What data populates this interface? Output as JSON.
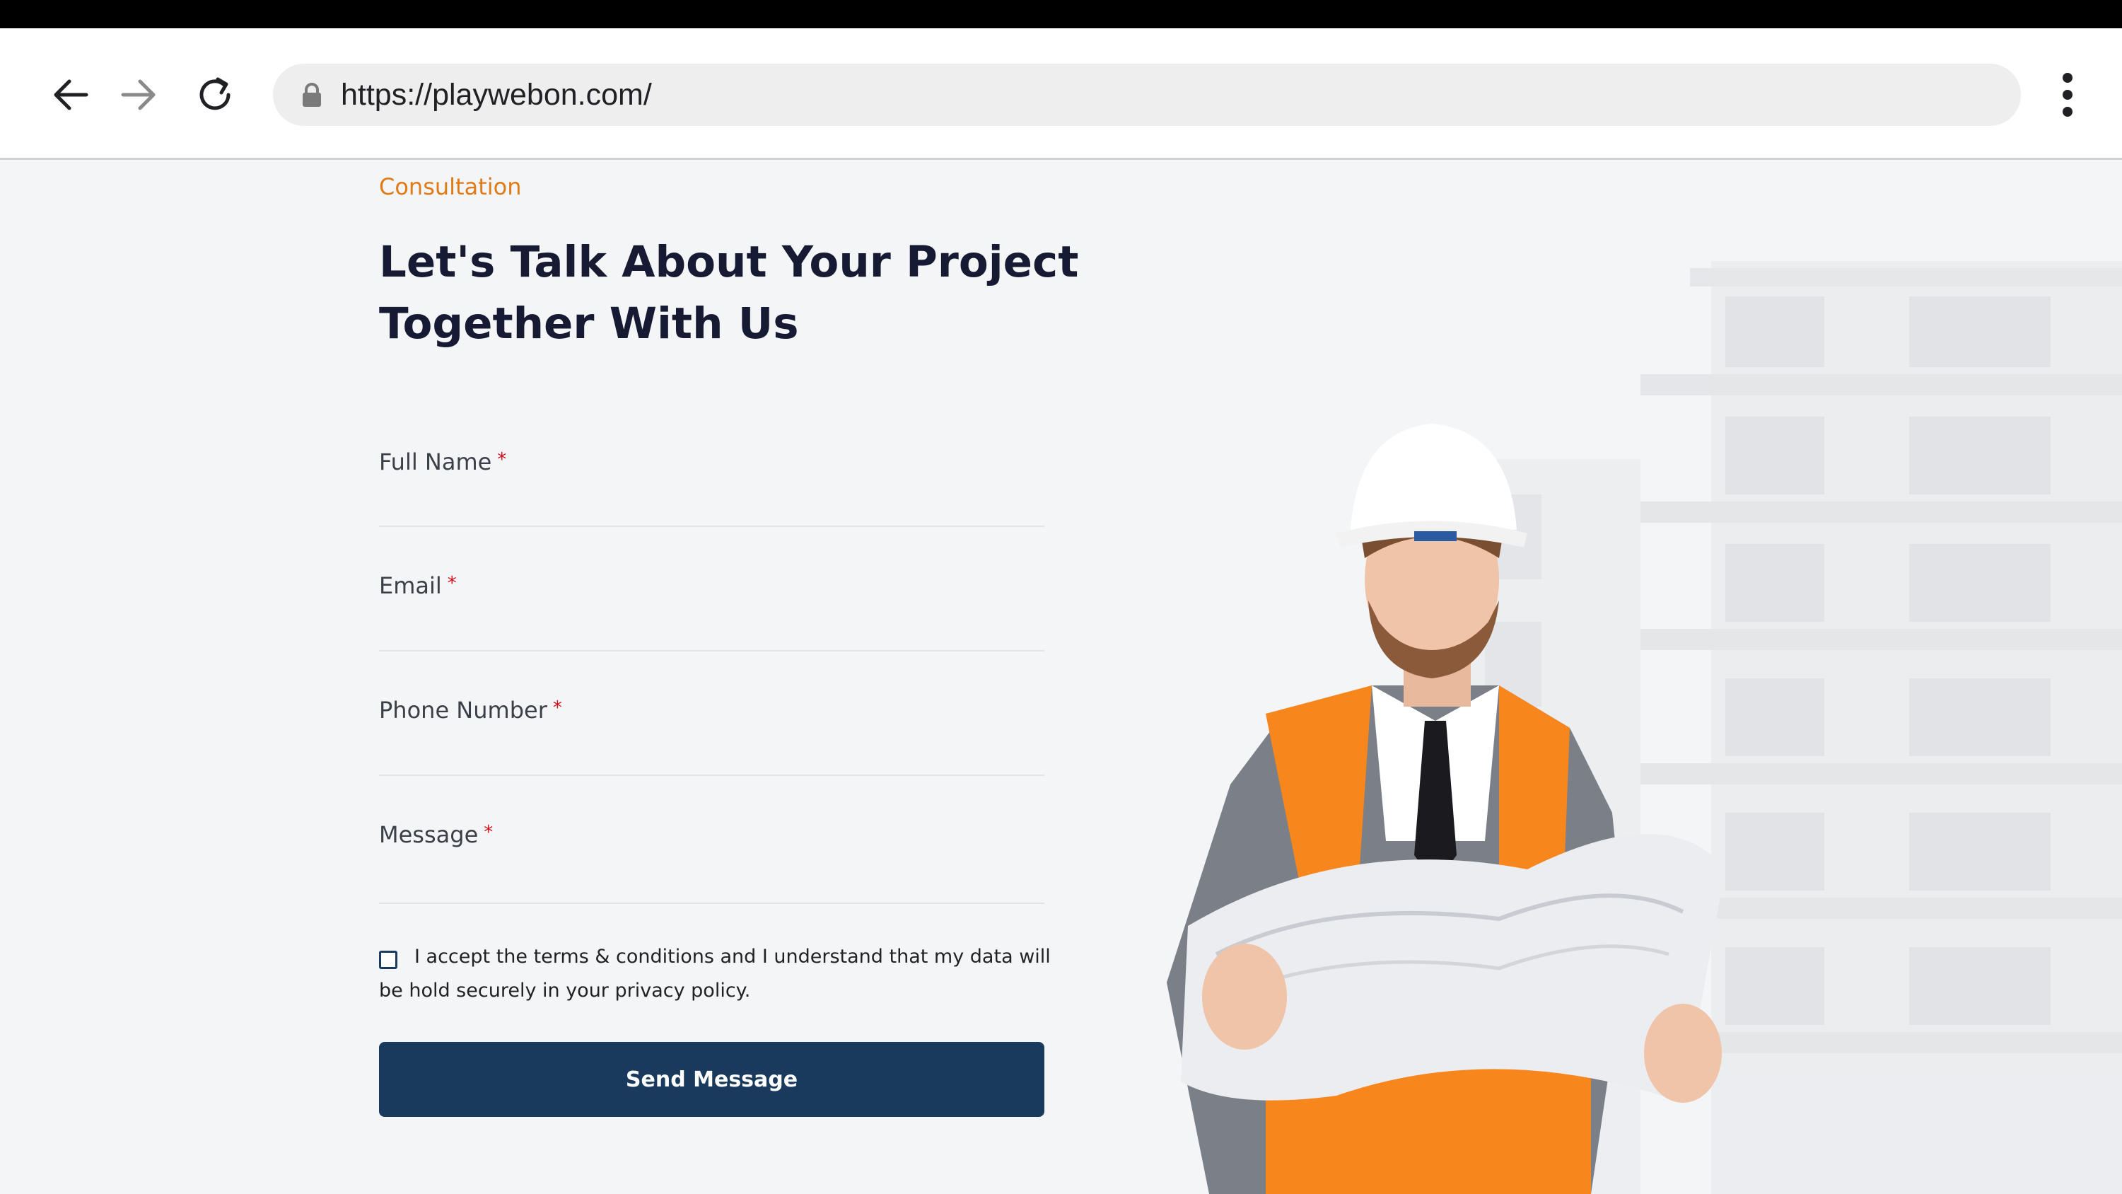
{
  "browser": {
    "url": "https://playwebon.com/"
  },
  "form": {
    "eyebrow": "Consultation",
    "headline": "Let's Talk About Your Project Together With Us",
    "fields": [
      {
        "label": "Full Name",
        "required_mark": "*"
      },
      {
        "label": "Email",
        "required_mark": "*"
      },
      {
        "label": "Phone Number",
        "required_mark": "*"
      },
      {
        "label": "Message",
        "required_mark": "*"
      }
    ],
    "consent_text": "I accept the terms & conditions and I understand that my data will be hold securely in your privacy policy.",
    "consent_checked": false,
    "submit_label": "Send Message"
  },
  "colors": {
    "accent": "#e07b17",
    "button": "#193a5c",
    "required": "#d40f1c",
    "vest": "#f7861d"
  }
}
